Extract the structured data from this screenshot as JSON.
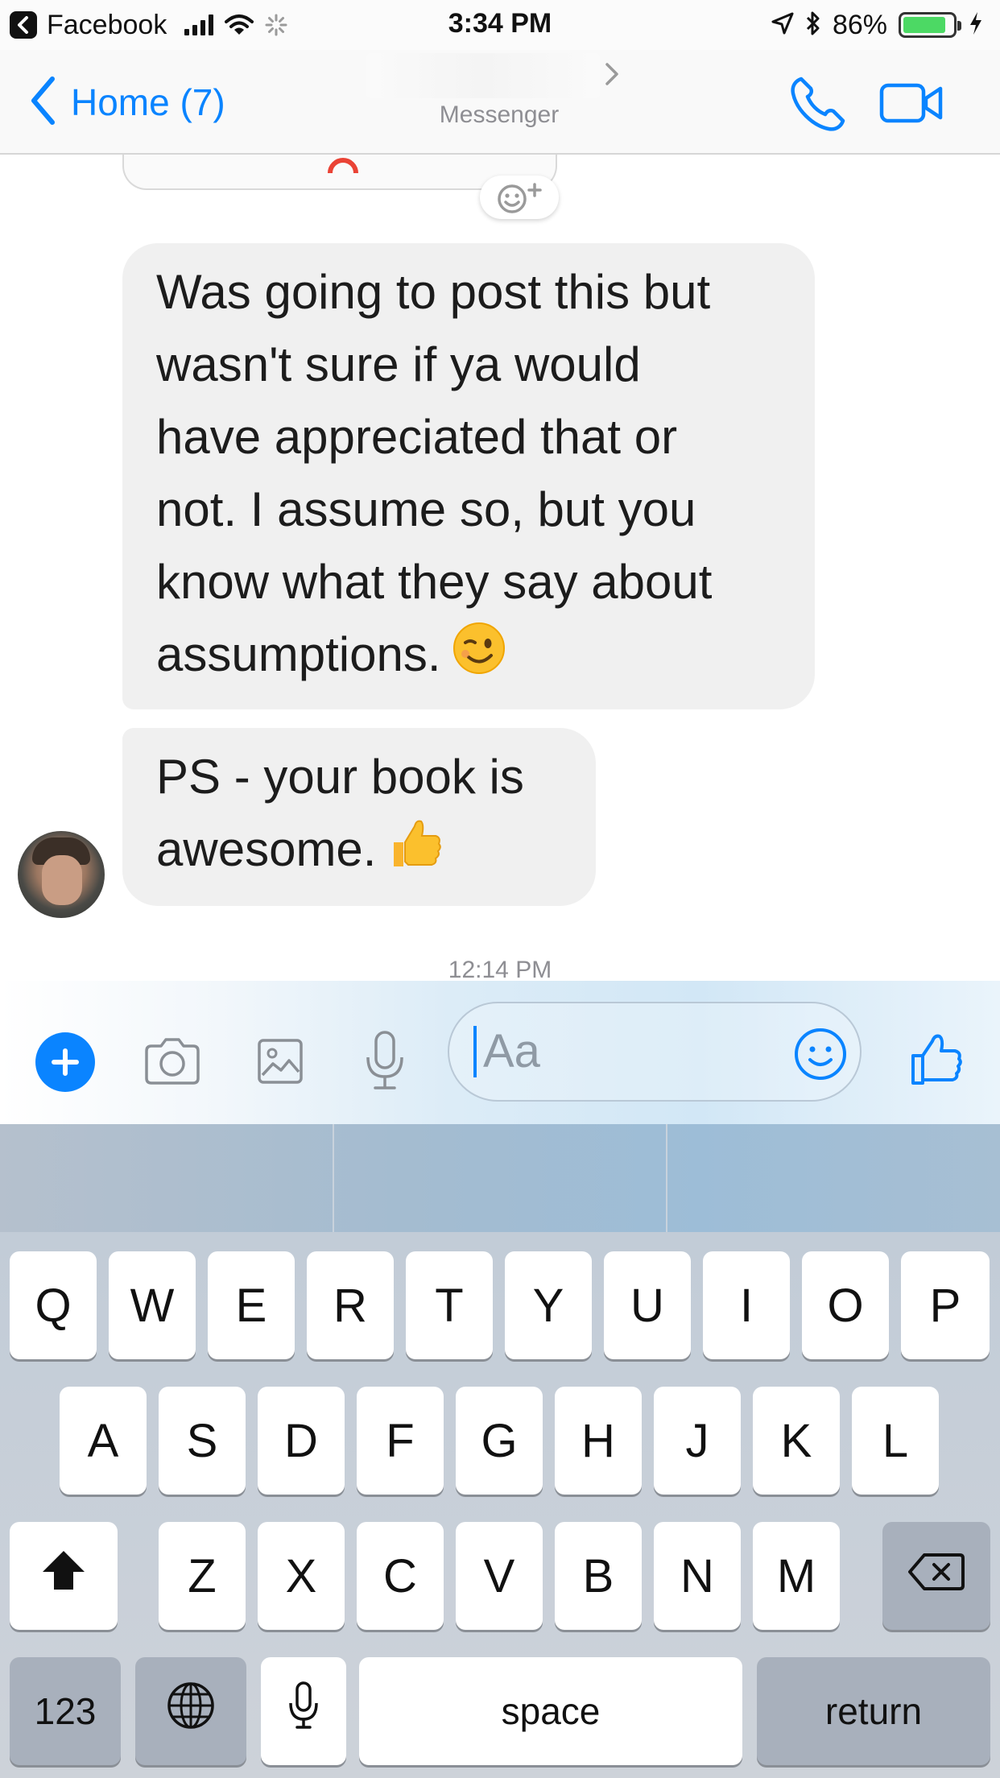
{
  "status_bar": {
    "back_app": "Facebook",
    "time": "3:34 PM",
    "battery": "86%",
    "battery_level": 0.86,
    "icons": [
      "back-arrow-icon",
      "signal-icon",
      "wifi-icon",
      "activity-spinner-icon",
      "location-arrow-icon",
      "bluetooth-icon",
      "battery-icon",
      "charging-bolt-icon"
    ]
  },
  "nav": {
    "back_label": "Home (7)",
    "subtitle": "Messenger",
    "icons": [
      "back-chevron-icon",
      "chevron-right-icon",
      "phone-icon",
      "video-camera-icon"
    ]
  },
  "conversation": {
    "messages": [
      {
        "lines": [
          "Was going to post this but",
          "wasn't sure if ya would",
          "have appreciated that or",
          "not.  I assume so, but you",
          "know what they say about",
          "assumptions."
        ],
        "emoji": "winking-face-emoji"
      },
      {
        "lines": [
          "PS - your book is",
          "awesome."
        ],
        "emoji": "thumbs-up-emoji"
      }
    ],
    "timestamp": "12:14 PM",
    "react_icon": "add-reaction-icon"
  },
  "composer": {
    "placeholder": "Aa",
    "icons": [
      "plus-icon",
      "camera-icon",
      "photo-gallery-icon",
      "microphone-icon",
      "smiley-icon",
      "like-thumb-icon"
    ],
    "accent": "#0a84ff"
  },
  "keyboard": {
    "row1": [
      "Q",
      "W",
      "E",
      "R",
      "T",
      "Y",
      "U",
      "I",
      "O",
      "P"
    ],
    "row2": [
      "A",
      "S",
      "D",
      "F",
      "G",
      "H",
      "J",
      "K",
      "L"
    ],
    "row3": [
      "Z",
      "X",
      "C",
      "V",
      "B",
      "N",
      "M"
    ],
    "numbers_label": "123",
    "space_label": "space",
    "return_label": "return",
    "icons": [
      "shift-arrow-icon",
      "backspace-icon",
      "globe-icon",
      "dictation-mic-icon"
    ]
  }
}
